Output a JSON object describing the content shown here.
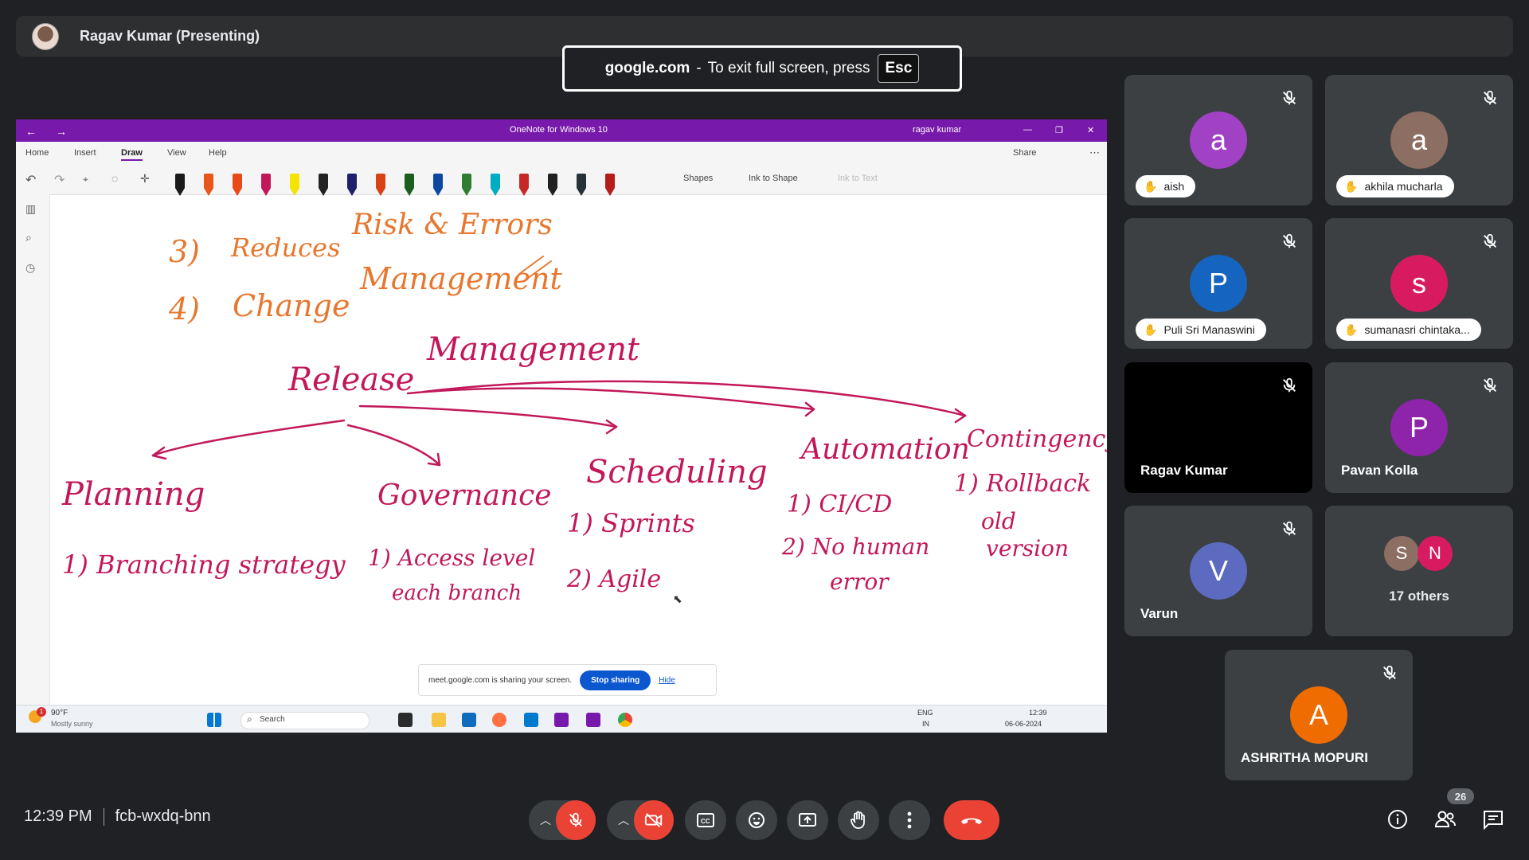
{
  "presenter": {
    "name": "Ragav Kumar (Presenting)"
  },
  "fullscreen_toast": {
    "domain": "google.com",
    "message": "To exit full screen, press",
    "key": "Esc"
  },
  "onenote": {
    "app_title": "OneNote for Windows 10",
    "user": "ragav kumar",
    "tabs": [
      "Home",
      "Insert",
      "Draw",
      "View",
      "Help"
    ],
    "active_tab": "Draw",
    "share_label": "Share",
    "shapes_label": "Shapes",
    "ink_to_shape_label": "Ink to Shape",
    "ink_to_text_label": "Ink to Text",
    "pen_colors": [
      "#1a1a1a",
      "#e8561a",
      "#e84a1a",
      "#c2185b",
      "#f5e400",
      "#222222",
      "#1f1f6b",
      "#d84315",
      "#1b5e20",
      "#0d47a1",
      "#2e7d32",
      "#00acc1",
      "#c62828",
      "#212121",
      "#263238",
      "#b71c1c"
    ],
    "ink": {
      "numbered_top": [
        "3)",
        "4)"
      ],
      "top_words": [
        "Reduces",
        "Risk & Errors",
        "Change",
        "Management"
      ],
      "center": [
        "Release",
        "Management"
      ],
      "branches": [
        "Planning",
        "Governance",
        "Scheduling",
        "Automation",
        "Contingency"
      ],
      "planning_notes": [
        "1) Branching strategy"
      ],
      "governance_notes": [
        "1) Access level",
        "each branch"
      ],
      "scheduling_notes": [
        "1) Sprints",
        "2) Agile"
      ],
      "automation_notes": [
        "1) CI/CD",
        "2) No human",
        "error"
      ],
      "contingency_notes": [
        "1) Rollback",
        "old",
        "version"
      ],
      "ink_color": "#c2185b",
      "accent_ink_color": "#e8772e"
    },
    "share_banner": {
      "text": "meet.google.com is sharing your screen.",
      "stop_label": "Stop sharing",
      "hide_label": "Hide"
    }
  },
  "taskbar": {
    "weather_temp": "90°F",
    "weather_desc": "Mostly sunny",
    "weather_badge": "1",
    "search_label": "Search",
    "lang": "ENG",
    "region": "IN",
    "time": "12:39",
    "date": "06-06-2024"
  },
  "participants": [
    {
      "name": "aish",
      "initial": "a",
      "color": "#a142c4",
      "style": "chip"
    },
    {
      "name": "akhila mucharla",
      "initial": "a",
      "color": "#8d6e63",
      "style": "chip"
    },
    {
      "name": "Puli Sri Manaswini",
      "initial": "P",
      "color": "#1565c0",
      "style": "chip"
    },
    {
      "name": "sumanasri chintaka...",
      "initial": "s",
      "color": "#d81b60",
      "style": "chip"
    },
    {
      "name": "Ragav Kumar",
      "initial": "",
      "color": "#000000",
      "style": "label"
    },
    {
      "name": "Pavan Kolla",
      "initial": "P",
      "color": "#8e24aa",
      "style": "label"
    },
    {
      "name": "Varun",
      "initial": "V",
      "color": "#5c6bc0",
      "style": "label"
    },
    {
      "name": "ASHRITHA MOPURI",
      "initial": "A",
      "color": "#ef6c00",
      "style": "label"
    }
  ],
  "others_tile": {
    "label": "17 others",
    "avatars": [
      {
        "initial": "S",
        "color": "#8d6e63"
      },
      {
        "initial": "N",
        "color": "#d81b60"
      }
    ]
  },
  "meeting": {
    "time": "12:39 PM",
    "code": "fcb-wxdq-bnn",
    "participant_count": "26"
  },
  "colors": {
    "end_call": "#ea4335",
    "meet_bg": "#202124",
    "tile_bg": "#3c4043"
  }
}
